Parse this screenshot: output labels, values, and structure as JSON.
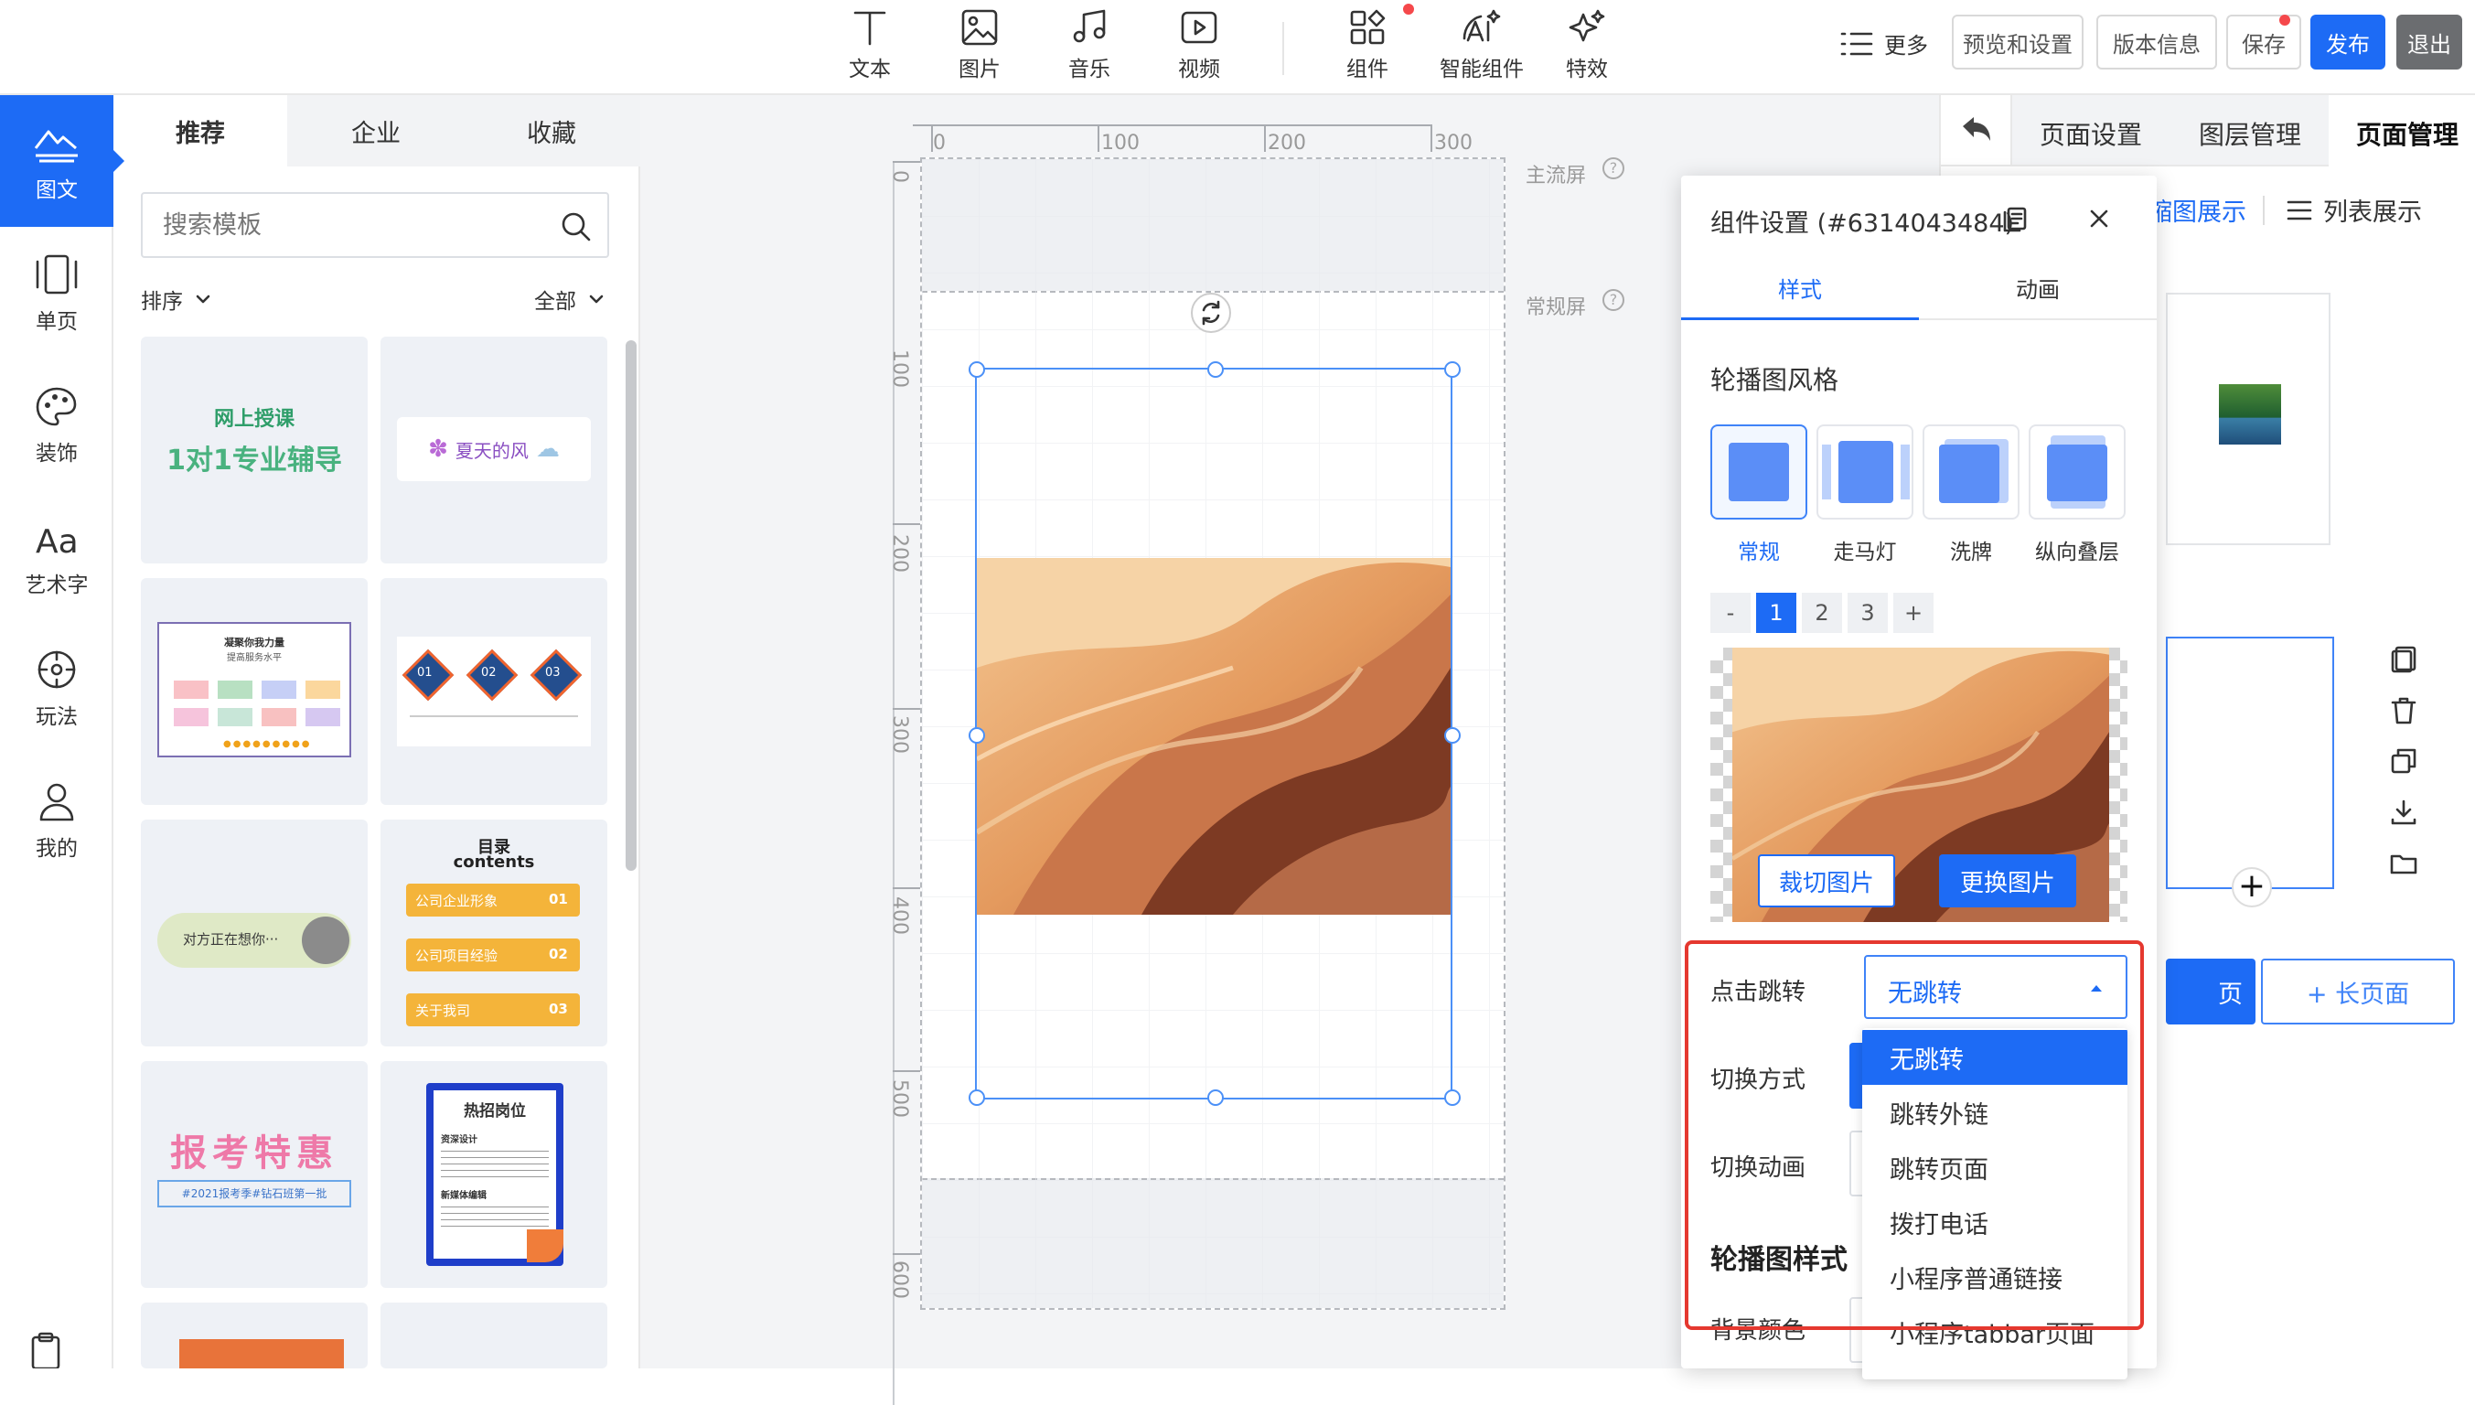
{
  "toolbar": {
    "tools": [
      {
        "label": "文本",
        "icon": "text-icon"
      },
      {
        "label": "图片",
        "icon": "image-icon"
      },
      {
        "label": "音乐",
        "icon": "music-icon"
      },
      {
        "label": "视频",
        "icon": "video-icon"
      },
      {
        "label": "组件",
        "icon": "components-icon"
      },
      {
        "label": "智能组件",
        "icon": "ai-components-icon"
      },
      {
        "label": "特效",
        "icon": "sparkle-icon"
      }
    ],
    "more": "更多",
    "preview": "预览和设置",
    "version": "版本信息",
    "save": "保存",
    "publish": "发布",
    "exit": "退出",
    "accent": "#1d6bf5"
  },
  "rail": {
    "items": [
      {
        "label": "图文",
        "icon": "image-text-icon"
      },
      {
        "label": "单页",
        "icon": "single-page-icon"
      },
      {
        "label": "装饰",
        "icon": "palette-icon"
      },
      {
        "label": "艺术字",
        "icon": "art-text-icon"
      },
      {
        "label": "玩法",
        "icon": "play-icon"
      },
      {
        "label": "我的",
        "icon": "user-icon"
      }
    ]
  },
  "templates": {
    "tabs": [
      "推荐",
      "企业",
      "收藏"
    ],
    "search_placeholder": "搜索模板",
    "sort_label": "排序",
    "filter_label": "全部",
    "cards": {
      "c1_line1": "网上授课",
      "c1_line2": "1对1专业辅导",
      "c2": "夏天的风",
      "c3_title": "凝聚你我力量",
      "c3_sub": "提高服务水平",
      "c4": [
        "01",
        "02",
        "03"
      ],
      "c5": "对方正在想你···",
      "c6_title": "目录",
      "c6_sub": "contents",
      "c6_rows": [
        "公司企业形象",
        "公司项目经验",
        "关于我司"
      ],
      "c6_nums": [
        "01",
        "02",
        "03"
      ],
      "c7_main": "报考特惠",
      "c7_sub": "#2021报考季#钻石班第一批",
      "c8_title": "热招岗位",
      "c8_s1": "资深设计",
      "c8_s2": "新媒体编辑"
    }
  },
  "canvas": {
    "ruler_top": [
      "0",
      "100",
      "200",
      "300"
    ],
    "ruler_left": [
      "0",
      "100",
      "200",
      "300",
      "400",
      "500",
      "600"
    ],
    "main_screen": "主流屏",
    "normal_screen": "常规屏"
  },
  "right_panel": {
    "tabs": [
      "页面设置",
      "图层管理",
      "页面管理"
    ],
    "view_modes": [
      "缩图展示",
      "列表展示"
    ],
    "add_page": "页",
    "add_long_page": "+ 长页面"
  },
  "popup": {
    "title": "组件设置 (#6314043484)",
    "tabs": [
      "样式",
      "动画"
    ],
    "section_style": "轮播图风格",
    "styles": [
      "常规",
      "走马灯",
      "洗牌",
      "纵向叠层"
    ],
    "pages": [
      "-",
      "1",
      "2",
      "3",
      "+"
    ],
    "crop": "裁切图片",
    "replace": "更换图片",
    "click_jump_label": "点击跳转",
    "click_jump_value": "无跳转",
    "switch_mode_label": "切换方式",
    "switch_anim_label": "切换动画",
    "section_carousel": "轮播图样式",
    "bg_color_label": "背景颜色",
    "dropdown_options": [
      "无跳转",
      "跳转外链",
      "跳转页面",
      "拨打电话",
      "小程序普通链接",
      "小程序tabbar页面"
    ]
  }
}
